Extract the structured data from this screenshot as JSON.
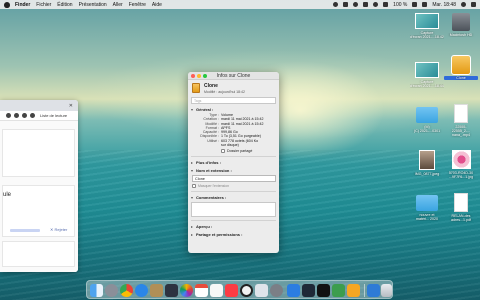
{
  "menubar": {
    "app_name": "Finder",
    "items": [
      "Fichier",
      "Édition",
      "Présentation",
      "Aller",
      "Fenêtre",
      "Aide"
    ],
    "battery": "100 %",
    "clock": "Mar. 18:48"
  },
  "browser": {
    "reading_list": "Liste de lecture",
    "page_word": "ule",
    "reject": "✕ Rejeter",
    "mini_count": "K  4/2"
  },
  "info_window": {
    "title": "Infos sur Clone",
    "name": "Clone",
    "modified_line": "Modifié : aujourd'hui 18:42",
    "tags_placeholder": "Tags",
    "general_header": "Général :",
    "general": [
      {
        "k": "Type :",
        "v": "Volume"
      },
      {
        "k": "Création :",
        "v": "mardi 11 mai 2021 à 15:42"
      },
      {
        "k": "Modifié :",
        "v": "mardi 11 mai 2021 à 15:42"
      },
      {
        "k": "Format :",
        "v": "APFS"
      },
      {
        "k": "Capacité :",
        "v": "999,86 Go"
      },
      {
        "k": "Disponible :",
        "v": "1 To (3,51 Go purgeable)"
      },
      {
        "k": "Utilisé :",
        "v": "603 778 octets (604 Ko"
      },
      {
        "k": "",
        "v": "sur disque)"
      }
    ],
    "shared_folder": "Dossier partagé",
    "more_info": "Plus d'infos :",
    "name_ext": "Nom et extension :",
    "name_value": "Clone",
    "hide_ext": "Masquer l'extension",
    "comments": "Commentaires :",
    "preview": "Aperçu :",
    "sharing": "Partage et permissions :"
  },
  "desktop_icons": [
    {
      "id": "screenshot-1",
      "type": "screen",
      "label": [
        "Capture",
        "d'écran 2021-...18.42.55"
      ]
    },
    {
      "id": "disk",
      "type": "disk",
      "label": [
        "Macintosh HD"
      ]
    },
    {
      "id": "screenshot-2",
      "type": "screen",
      "label": [
        "Capture",
        "d'écran 2021-...18.44.47"
      ]
    },
    {
      "id": "clone",
      "type": "ext",
      "label": [
        "Clone"
      ]
    },
    {
      "id": "folder-1",
      "type": "folder",
      "label": [
        "(M)",
        "(C) 2021-...0301"
      ]
    },
    {
      "id": "doc-1",
      "type": "doc",
      "label": [
        "22555-",
        "22555_2-...",
        "nana_.mp4"
      ]
    },
    {
      "id": "folder-2",
      "type": "folder",
      "label": [
        "Dossier",
        "copier ... 2 .pl"
      ]
    },
    {
      "id": "doc-2",
      "type": "doc",
      "label": [
        "22555-",
        "22555_2 ...",
        "page_.zip"
      ]
    },
    {
      "id": "photo-1",
      "type": "photo",
      "label": [
        "IMG_0877.jpeg"
      ]
    },
    {
      "id": "flower",
      "type": "flower",
      "label": [
        "5703-RO4D-30",
        "...9F7F6...1.jpg"
      ]
    },
    {
      "id": "folder-3",
      "type": "folder",
      "label": [
        "nouvre et",
        "matéri... 2020"
      ]
    },
    {
      "id": "doc-3",
      "type": "doc",
      "label": [
        "RELAN-des",
        "adres...1.pdf"
      ]
    }
  ],
  "dock_apps": [
    "finder-icon",
    "launchpad-icon",
    "chrome-icon",
    "safari-icon",
    "mail-icon",
    "notes-icon",
    "photos-icon",
    "calendar-icon",
    "music-icon",
    "appstore-icon",
    "quicktime-icon",
    "preview-icon",
    "settings-icon",
    "word-icon",
    "keynote-icon",
    "terminal-icon",
    "activity-icon",
    "numbers-icon",
    "pages-icon",
    "downloads-icon",
    "trash-icon"
  ],
  "colors": {
    "selection": "#2f6ad9",
    "traffic_close": "#fe5f57",
    "traffic_min": "#febc2e",
    "traffic_zoom": "#28c840"
  }
}
